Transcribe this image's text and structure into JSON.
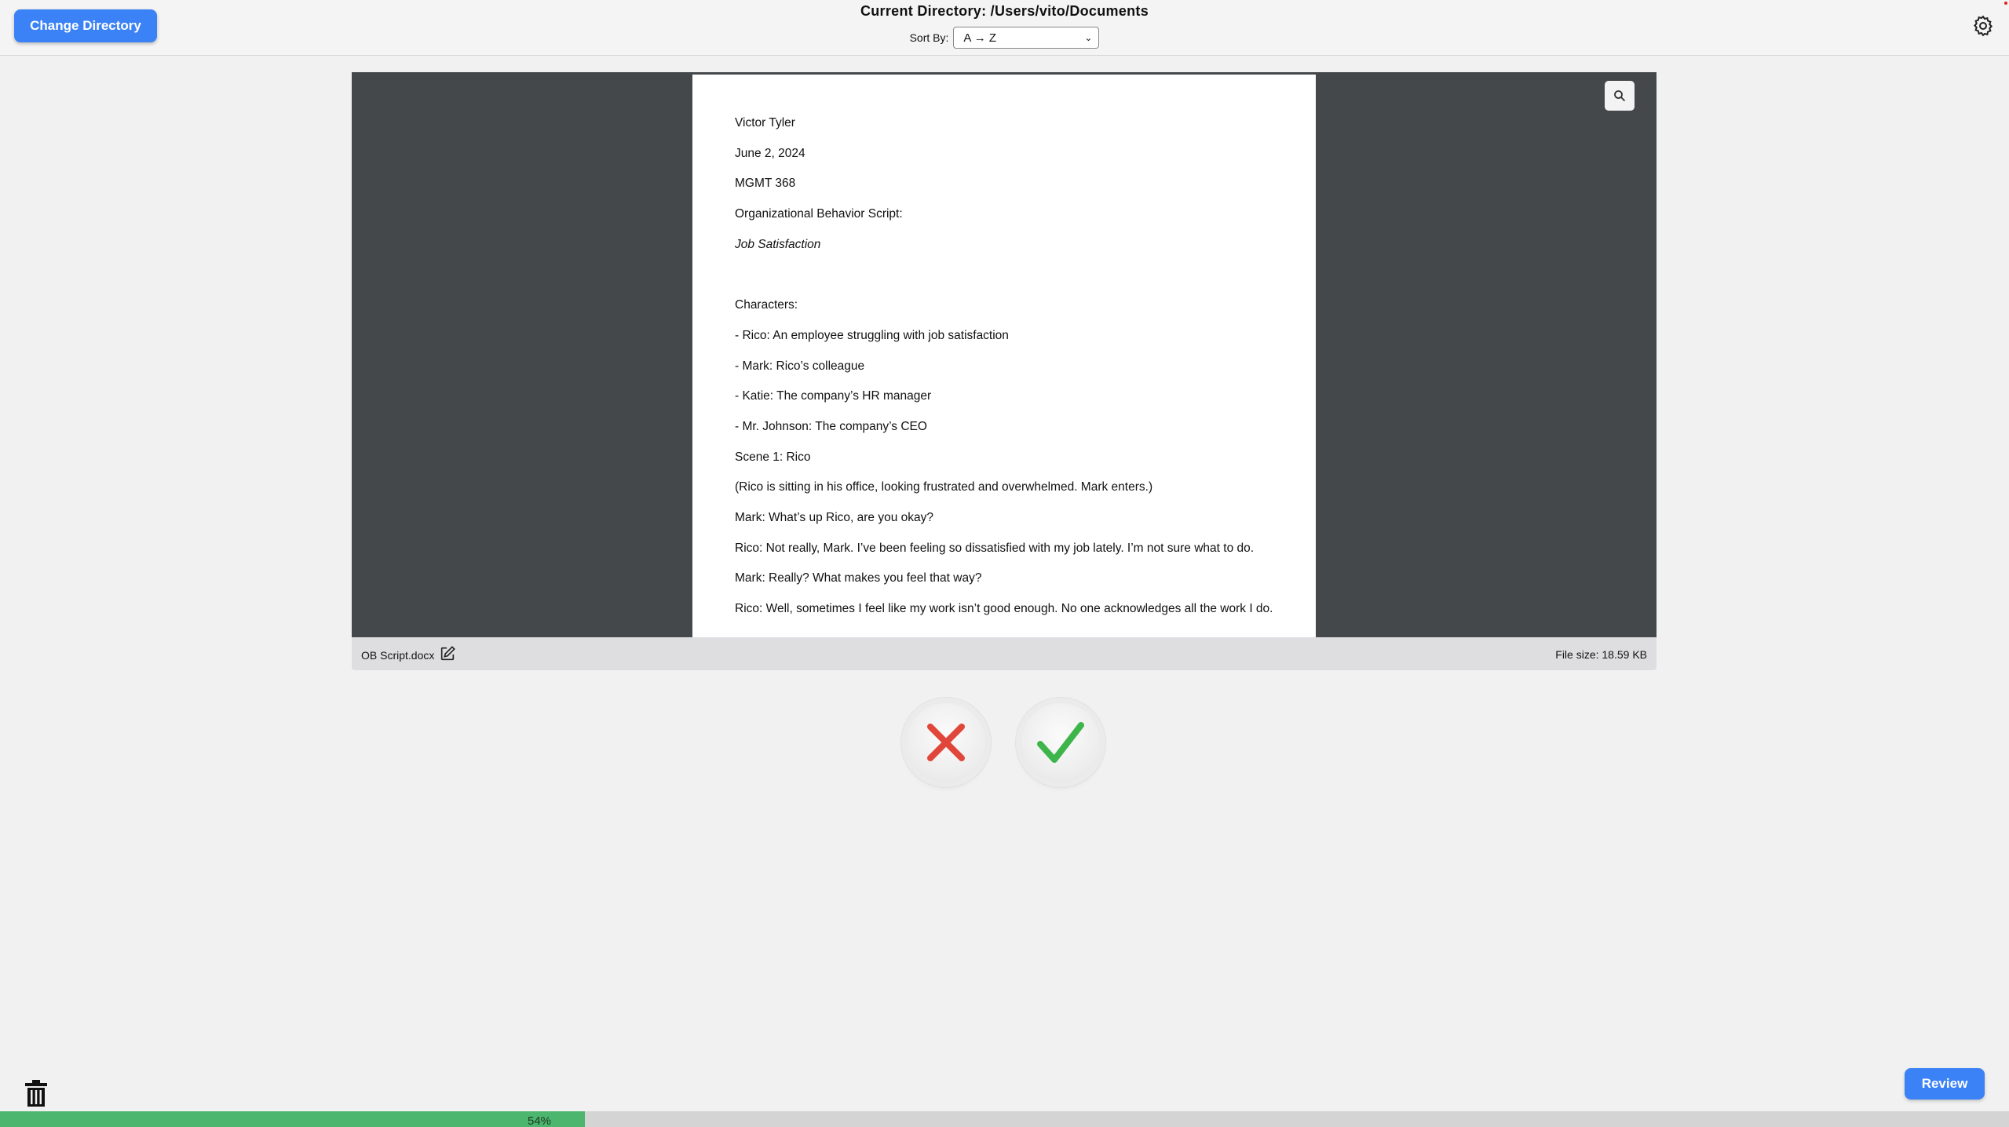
{
  "header": {
    "change_directory_label": "Change Directory",
    "current_directory": "Current Directory: /Users/vito/Documents",
    "sort_label": "Sort By:",
    "sort_selected": "A → Z",
    "settings_icon": "gear-icon"
  },
  "preview": {
    "zoom_icon": "magnifier-icon",
    "document_lines": [
      "Victor Tyler",
      "June 2, 2024",
      "MGMT 368",
      "Organizational Behavior Script:",
      "Job Satisfaction",
      "Characters:",
      "- Rico: An employee struggling with job satisfaction",
      "- Mark: Rico’s colleague",
      "- Katie: The company’s HR manager",
      "- Mr. Johnson: The company’s CEO",
      "Scene 1: Rico",
      "(Rico is sitting in his office, looking frustrated and overwhelmed. Mark enters.)",
      "Mark: What’s up Rico, are you okay?",
      "Rico: Not really, Mark. I’ve been feeling so dissatisfied with my job lately. I’m not sure what to do.",
      "Mark: Really? What makes you feel that way?",
      "Rico: Well, sometimes I feel like my work isn’t good enough. No one acknowledges all the work I do."
    ]
  },
  "file_info": {
    "name": "OB Script.docx",
    "size": "File size: 18.59 KB"
  },
  "actions": {
    "reject_icon": "x-icon",
    "accept_icon": "check-icon",
    "trash_icon": "trash-icon",
    "review_label": "Review"
  },
  "progress": {
    "percent": 54,
    "label": "54%"
  },
  "colors": {
    "accent": "#3b82f6",
    "reject": "#e0473a",
    "accept": "#3db54a",
    "progress": "#4cb56e"
  }
}
